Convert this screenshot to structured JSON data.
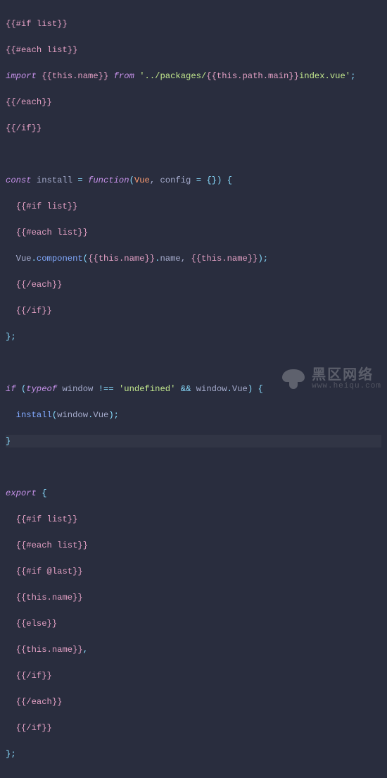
{
  "code": {
    "l1": "{{#if list}}",
    "l2": "{{#each list}}",
    "l3_import": "import",
    "l3_name": " {{this.name}} ",
    "l3_from": "from",
    "l3_q1": " '",
    "l3_path_a": "../packages/",
    "l3_tpl": "{{this.path.main}}",
    "l3_path_b": "index.vue",
    "l3_q2": "'",
    "l3_semi": ";",
    "l4": "{{/each}}",
    "l5": "{{/if}}",
    "l7_const": "const",
    "l7_install": " install ",
    "l7_eq": "=",
    "l7_function": " function",
    "l7_p1": "(",
    "l7_vue": "Vue",
    "l7_c": ", ",
    "l7_config": "config ",
    "l7_eq2": "=",
    "l7_obj": " {}",
    "l7_p2": ") ",
    "l7_b1": "{",
    "l8": "  {{#if list}}",
    "l9": "  {{#each list}}",
    "l10_pre": "  Vue",
    "l10_dot1": ".",
    "l10_comp": "component",
    "l10_p1": "(",
    "l10_arg1": "{{this.name}}",
    "l10_dot2": ".",
    "l10_nm": "name",
    "l10_c": ", ",
    "l10_arg2": "{{this.name}}",
    "l10_p2": ")",
    "l10_semi": ";",
    "l11": "  {{/each}}",
    "l12": "  {{/if}}",
    "l13": "};",
    "l15_if": "if",
    "l15_p1": " (",
    "l15_typeof": "typeof",
    "l15_win": " window ",
    "l15_neq": "!==",
    "l15_sp1": " ",
    "l15_str": "'undefined'",
    "l15_sp2": " ",
    "l15_and": "&&",
    "l15_win2": " window",
    "l15_dot": ".",
    "l15_vue": "Vue",
    "l15_p2": ") ",
    "l15_b1": "{",
    "l16_call": "  install",
    "l16_p1": "(",
    "l16_arg": "window",
    "l16_dot": ".",
    "l16_vue": "Vue",
    "l16_p2": ")",
    "l16_semi": ";",
    "l17": "}",
    "l19_export": "export",
    "l19_b": " {",
    "l20": "  {{#if list}}",
    "l21": "  {{#each list}}",
    "l22": "  {{#if @last}}",
    "l23": "  {{this.name}}",
    "l24": "  {{else}}",
    "l25a": "  {{this.name}}",
    "l25b": ",",
    "l26": "  {{/if}}",
    "l27": "  {{/each}}",
    "l28": "  {{/if}}",
    "l29": "};"
  },
  "watermark": {
    "main": "黑区网络",
    "sub": "www.heiqu.com"
  }
}
